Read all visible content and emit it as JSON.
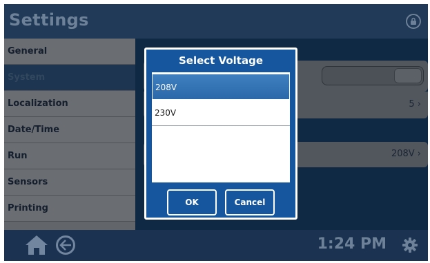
{
  "header": {
    "title": "Settings",
    "lock_icon": "lock-icon"
  },
  "sidebar": {
    "items": [
      {
        "label": "General",
        "selected": false
      },
      {
        "label": "System",
        "selected": true
      },
      {
        "label": "Localization",
        "selected": false
      },
      {
        "label": "Date/Time",
        "selected": false
      },
      {
        "label": "Run",
        "selected": false
      },
      {
        "label": "Sensors",
        "selected": false
      },
      {
        "label": "Printing",
        "selected": false
      }
    ]
  },
  "content": {
    "row2_value": "5",
    "row3_value": "208V"
  },
  "dialog": {
    "title": "Select Voltage",
    "options": [
      {
        "label": "208V",
        "selected": true
      },
      {
        "label": "230V",
        "selected": false
      }
    ],
    "ok_label": "OK",
    "cancel_label": "Cancel"
  },
  "bottombar": {
    "home_icon": "home-icon",
    "back_icon": "back-arrow-icon",
    "time": "1:24 PM",
    "settings_icon": "gear-icon"
  },
  "colors": {
    "dialog_blue": "#15569e",
    "selected_option": "#2f6fb0",
    "header_bg": "#213a57"
  }
}
